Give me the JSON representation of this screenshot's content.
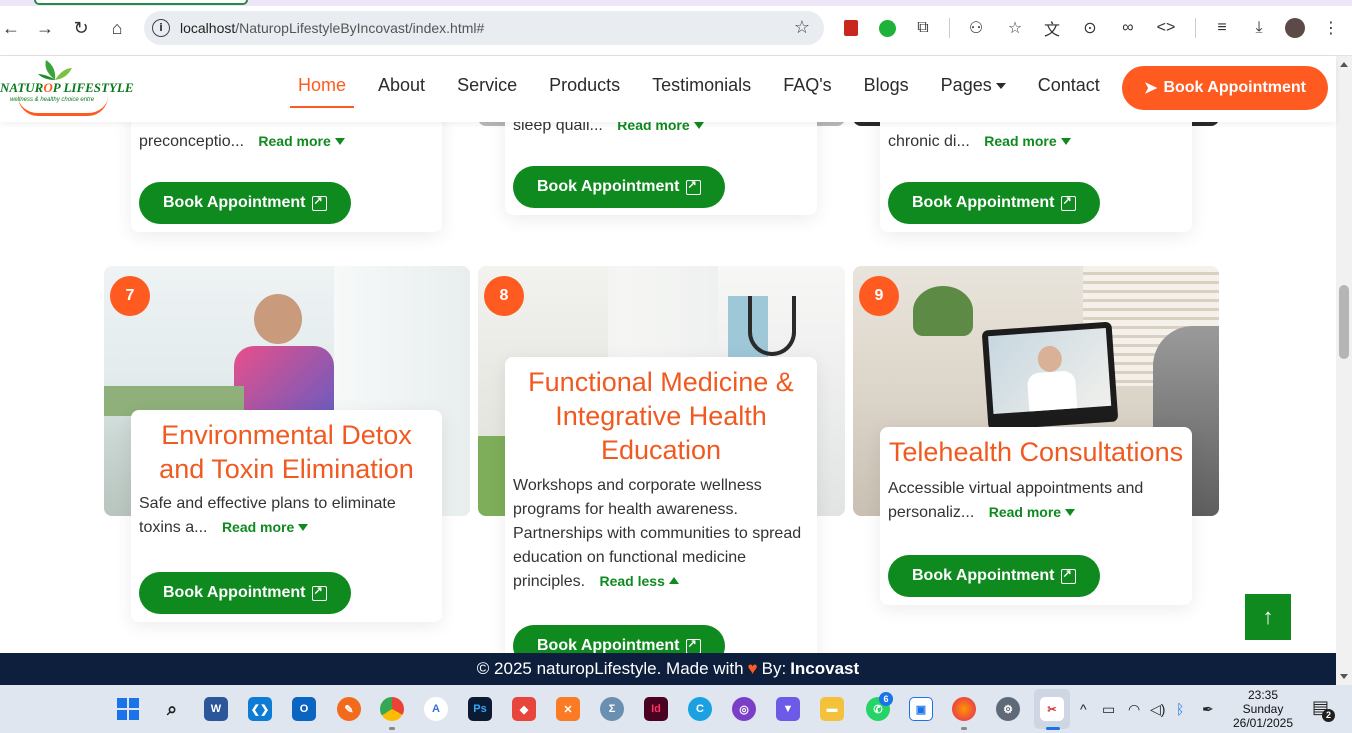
{
  "browser": {
    "url_host": "localhost",
    "url_path": "/NaturopLifestyleByIncovast/index.html#",
    "nav": [
      "back-icon",
      "forward-icon",
      "reload-icon",
      "home-icon"
    ],
    "extensions": [
      "pdf-icon",
      "green-extension-icon",
      "puzzle-icon",
      "incognito-icon",
      "bookmark-star-icon",
      "translate-icon",
      "screenshot-icon",
      "link-icon",
      "code-icon",
      "reading-list-icon",
      "download-icon",
      "profile-avatar",
      "menu-icon"
    ]
  },
  "header": {
    "logo_text_1": "NATUR",
    "logo_text_o": "O",
    "logo_text_2": "P LIFESTYLE",
    "logo_tagline": "wellness & healthy choice    entre",
    "nav": [
      {
        "label": "Home"
      },
      {
        "label": "About"
      },
      {
        "label": "Service"
      },
      {
        "label": "Products"
      },
      {
        "label": "Testimonials"
      },
      {
        "label": "FAQ's"
      },
      {
        "label": "Blogs"
      },
      {
        "label": "Pages"
      },
      {
        "label": "Contact"
      }
    ],
    "book_label": "Book Appointment"
  },
  "row_top": [
    {
      "desc": "preconceptio...",
      "read": "Read more",
      "book": "Book Appointment"
    },
    {
      "desc": "sleep quali...",
      "read": "Read more",
      "book": "Book Appointment"
    },
    {
      "desc": "chronic di...",
      "read": "Read more",
      "book": "Book Appointment"
    }
  ],
  "cards": [
    {
      "number": "7",
      "title": "Environmental Detox and Toxin Elimination",
      "desc": "Safe and effective plans to eliminate toxins a...",
      "read": "Read more",
      "book": "Book Appointment"
    },
    {
      "number": "8",
      "title": "Functional Medicine & Integrative Health Education",
      "desc": "Workshops and corporate wellness programs for health awareness. Partnerships with communities to spread education on functional medicine principles.",
      "read": "Read less",
      "book": "Book Appointment"
    },
    {
      "number": "9",
      "title": "Telehealth Consultations",
      "desc": "Accessible virtual appointments and personaliz...",
      "read": "Read more",
      "book": "Book Appointment"
    }
  ],
  "footer": {
    "copyright": "© 2025 naturopLifestyle. Made with",
    "by": "By:",
    "brand": "Incovast"
  },
  "taskbar": {
    "time": "23:35",
    "day": "Sunday",
    "date": "26/01/2025",
    "notification_count": "2",
    "whatsapp_badge": "6"
  },
  "colors": {
    "accent_orange": "#ff5a1f",
    "brand_green": "#0f8a1f",
    "footer_navy": "#0d1f3c"
  }
}
